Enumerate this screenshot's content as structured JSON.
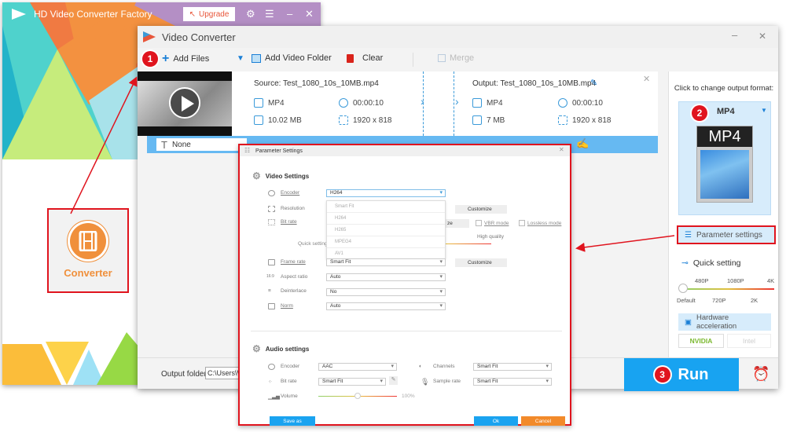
{
  "bg_window": {
    "title": "HD Video Converter Factory",
    "upgrade_label": "Upgrade",
    "converter_label": "Converter"
  },
  "main_window": {
    "title": "Video Converter",
    "toolbar": {
      "add_files": "Add Files",
      "add_video_folder": "Add Video Folder",
      "clear": "Clear",
      "merge": "Merge"
    },
    "file": {
      "source": "Source: Test_1080_10s_10MB.mp4",
      "output": "Output: Test_1080_10s_10MB.mp4",
      "src_format": "MP4",
      "src_duration": "00:00:10",
      "src_size": "10.02 MB",
      "src_resolution": "1920 x 818",
      "out_format": "MP4",
      "out_duration": "00:00:10",
      "out_size": "7 MB",
      "out_resolution": "1920 x 818"
    },
    "subtitle_select": "None",
    "output_folder_label": "Output folder:",
    "output_folder_value": "C:\\Users\\W",
    "run_label": "Run"
  },
  "right_panel": {
    "format_prompt": "Click to change output format:",
    "format": "MP4",
    "format_image_text": "MP4",
    "parameter_settings": "Parameter settings",
    "quick_setting": "Quick setting",
    "quick_top": [
      "480P",
      "1080P",
      "4K"
    ],
    "quick_bottom": [
      "Default",
      "720P",
      "2K"
    ],
    "quick_value": "Default",
    "hardware_acceleration": "Hardware acceleration",
    "nvidia": "NVIDIA",
    "intel": "Intel"
  },
  "badges": [
    "1",
    "2",
    "3"
  ],
  "dialog": {
    "title": "Parameter Settings",
    "video_heading": "Video Settings",
    "video_rows": [
      {
        "label": "Encoder",
        "value": "H264"
      },
      {
        "label": "Resolution",
        "value": ""
      },
      {
        "label": "Bit rate",
        "value": ""
      },
      {
        "label": "Frame rate",
        "value": "Smart Fit"
      },
      {
        "label": "Aspect ratio",
        "value": "Auto"
      },
      {
        "label": "Deinterlace",
        "value": "No"
      },
      {
        "label": "Norm",
        "value": "Auto"
      }
    ],
    "encoder_options": [
      "Smart Fit",
      "H264",
      "H265",
      "MPEG4",
      "AV1"
    ],
    "customize": "Customize",
    "customize_partial": "ze",
    "vbr_mode": "VBR mode",
    "lossless_mode": "Lossless mode",
    "quick_setting_partial": "Quick setting",
    "high_quality": "High quality",
    "audio_heading": "Audio settings",
    "audio": {
      "encoder_label": "Encoder",
      "encoder": "AAC",
      "bitrate_label": "Bit rate",
      "bitrate": "Smart Fit",
      "volume_label": "Volume",
      "volume": "100%",
      "channels_label": "Channels",
      "channels": "Smart Fit",
      "samplerate_label": "Sample rate",
      "samplerate": "Smart Fit"
    },
    "save_as": "Save as",
    "ok": "Ok",
    "cancel": "Cancel"
  }
}
